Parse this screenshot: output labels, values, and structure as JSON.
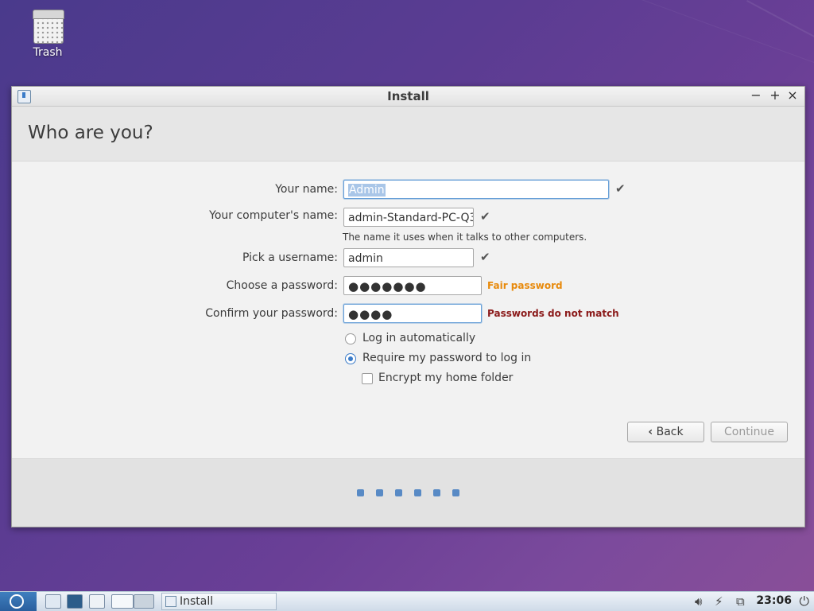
{
  "desktop": {
    "trash_label": "Trash"
  },
  "window": {
    "title": "Install",
    "controls": {
      "minimize": "−",
      "maximize": "+",
      "close": "×"
    },
    "heading": "Who are you?"
  },
  "form": {
    "name_label": "Your name:",
    "name_value": "Admin",
    "computer_label": "Your computer's name:",
    "computer_value": "admin-Standard-PC-Q3",
    "computer_hint": "The name it uses when it talks to other computers.",
    "username_label": "Pick a username:",
    "username_value": "admin",
    "password_label": "Choose a password:",
    "password_value": "●●●●●●●",
    "password_strength": "Fair password",
    "confirm_label": "Confirm your password:",
    "confirm_value": "●●●●",
    "confirm_status": "Passwords do not match",
    "valid_mark": "✔",
    "login_auto_label": "Log in automatically",
    "login_password_label": "Require my password to log in",
    "encrypt_label": "Encrypt my home folder"
  },
  "buttons": {
    "back_icon": "‹",
    "back_label": "Back",
    "continue_label": "Continue"
  },
  "colors": {
    "accent": "#3a7bc8",
    "fair_password": "#e88a0c",
    "mismatch": "#8b1a1a"
  },
  "progress": {
    "total_steps": 6
  },
  "taskbar": {
    "task_label": "Install",
    "clock": "23:06",
    "volume_icon": "speaker-icon",
    "power_icon": "power-icon"
  }
}
